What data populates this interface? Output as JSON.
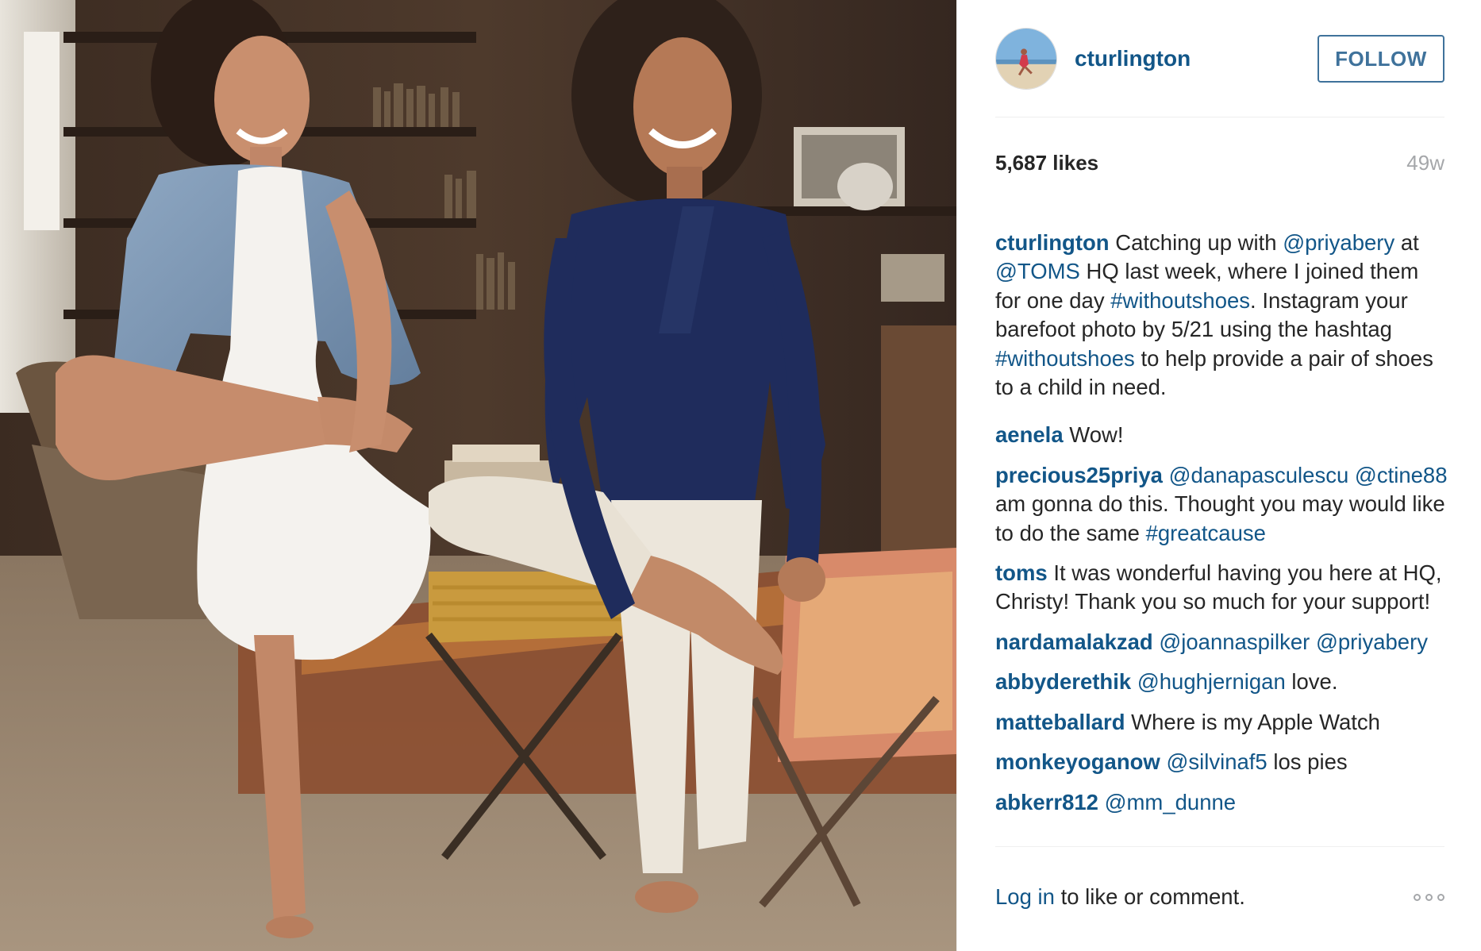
{
  "post": {
    "username": "cturlington",
    "follow_label": "FOLLOW",
    "likes": "5,687 likes",
    "age": "49w"
  },
  "caption": {
    "user": "cturlington",
    "t1": "Catching up with ",
    "m1": "@priyabery",
    "t2": " at ",
    "m2": "@TOMS",
    "t3": " HQ last week, where I joined them for one day ",
    "h1": "#withoutshoes",
    "t4": ". Instagram your barefoot photo by 5/21 using the hashtag ",
    "h2": "#withoutshoes",
    "t5": " to help provide a pair of shoes to a child in need."
  },
  "comments": [
    {
      "user": "aenela",
      "text": "Wow!"
    },
    {
      "user": "precious25priya",
      "m1": "@danapasculescu",
      "m2": "@ctine88",
      "text": " am gonna do this. Thought you may would like to do the same ",
      "tag": "#greatcause"
    },
    {
      "user": "toms",
      "text": "It was wonderful having you here at HQ, Christy! Thank you so much for your support!"
    },
    {
      "user": "nardamalakzad",
      "m1": "@joannaspilker",
      "m2": "@priyabery"
    },
    {
      "user": "abbyderethik",
      "m1": "@hughjernigan",
      "text": " love."
    },
    {
      "user": "matteballard",
      "text": "Where is my Apple Watch"
    },
    {
      "user": "monkeyoganow",
      "m1": "@silvinaf5",
      "text": " los pies"
    },
    {
      "user": "abkerr812",
      "m1": "@mm_dunne"
    }
  ],
  "footer": {
    "login": "Log in",
    "rest": " to like or comment."
  },
  "colors": {
    "link": "#125688",
    "follow": "#3f729b",
    "muted": "#a5a7aa",
    "text": "#262626"
  },
  "icons": {
    "more": "more-options-icon",
    "avatar": "avatar"
  }
}
